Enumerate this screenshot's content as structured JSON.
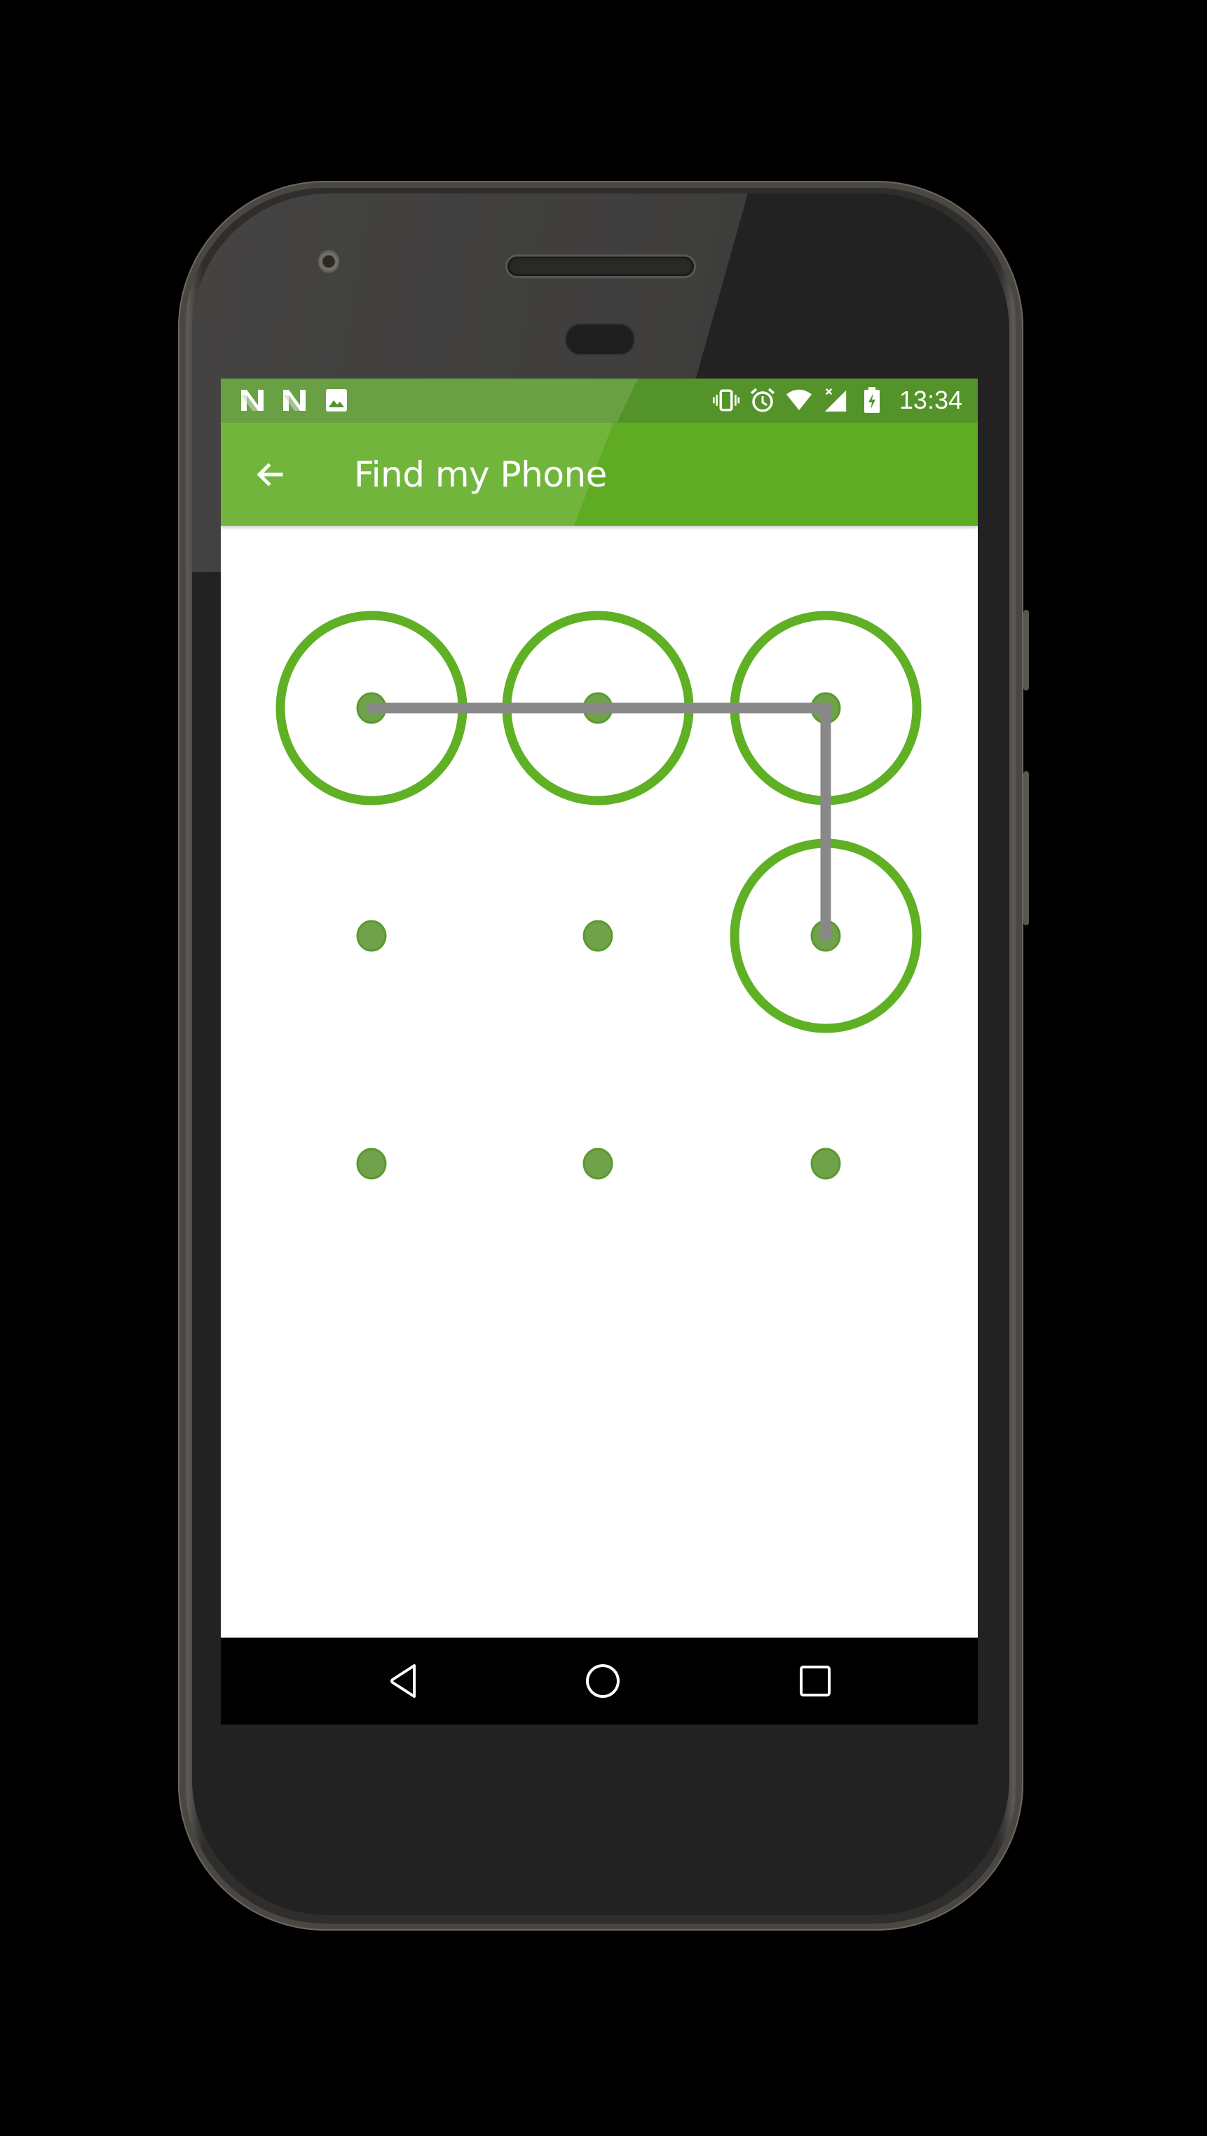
{
  "device": {
    "model": "Android phone",
    "frame_color": "#2f2e2d"
  },
  "status_bar": {
    "left_icons": [
      "n-notification-icon",
      "n-notification-icon",
      "image-notification-icon"
    ],
    "right_icons": [
      "vibrate-icon",
      "alarm-icon",
      "wifi-icon",
      "signal-no-data-icon",
      "battery-charging-icon"
    ],
    "time": "13:34",
    "background": "#54932a"
  },
  "app_bar": {
    "back_icon": "arrow-left-icon",
    "title": "Find my Phone",
    "background": "#5fab22"
  },
  "pattern_lock": {
    "grid_size": 3,
    "dot_color": "#6fa24a",
    "ring_color": "#5fb024",
    "line_color": "#888888",
    "nodes": [
      {
        "row": 0,
        "col": 0,
        "selected": true
      },
      {
        "row": 0,
        "col": 1,
        "selected": true
      },
      {
        "row": 0,
        "col": 2,
        "selected": true
      },
      {
        "row": 1,
        "col": 0,
        "selected": false
      },
      {
        "row": 1,
        "col": 1,
        "selected": false
      },
      {
        "row": 1,
        "col": 2,
        "selected": true
      },
      {
        "row": 2,
        "col": 0,
        "selected": false
      },
      {
        "row": 2,
        "col": 1,
        "selected": false
      },
      {
        "row": 2,
        "col": 2,
        "selected": false
      }
    ],
    "path": [
      [
        0,
        0
      ],
      [
        0,
        1
      ],
      [
        0,
        2
      ],
      [
        1,
        2
      ]
    ]
  },
  "nav_bar": {
    "buttons": [
      {
        "name": "back",
        "icon": "triangle-back-icon"
      },
      {
        "name": "home",
        "icon": "circle-home-icon"
      },
      {
        "name": "recents",
        "icon": "square-recents-icon"
      }
    ]
  }
}
